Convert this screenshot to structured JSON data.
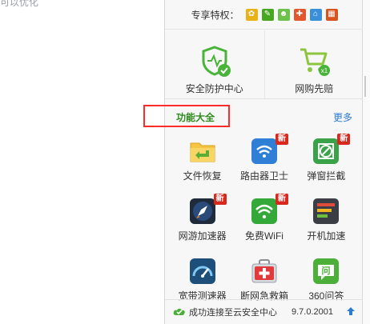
{
  "background": {
    "partial_text": "可以优化"
  },
  "privileges": {
    "label": "专享特权：",
    "icons": [
      "tiger-icon",
      "leaf-icon",
      "frog-icon",
      "gift-icon",
      "home-icon",
      "grid-icon"
    ]
  },
  "top_features": [
    {
      "name": "security-center",
      "label": "安全防护中心"
    },
    {
      "name": "shopping-protect",
      "label": "网购先赔",
      "badge": "x1"
    }
  ],
  "section": {
    "title": "功能大全",
    "more": "更多"
  },
  "tools": [
    {
      "name": "file-recovery",
      "label": "文件恢复",
      "new": false
    },
    {
      "name": "router-guard",
      "label": "路由器卫士",
      "new": true
    },
    {
      "name": "popup-blocker",
      "label": "弹窗拦截",
      "new": true
    },
    {
      "name": "game-accelerator",
      "label": "网游加速器",
      "new": true
    },
    {
      "name": "free-wifi",
      "label": "免费WiFi",
      "new": true
    },
    {
      "name": "startup-accelerator",
      "label": "开机加速",
      "new": false
    },
    {
      "name": "speed-test",
      "label": "宽带测速器",
      "new": false
    },
    {
      "name": "network-rescue",
      "label": "断网急救箱",
      "new": false
    },
    {
      "name": "qa-360",
      "label": "360问答",
      "new": false
    }
  ],
  "new_badge": "新",
  "status": {
    "text": "成功连接至云安全中心",
    "version": "9.7.0.2001"
  },
  "colors": {
    "accent_green": "#2e8b1d",
    "link_blue": "#2b7bd4",
    "badge_red": "#d8281e",
    "highlight_red": "#ff2a2a"
  }
}
